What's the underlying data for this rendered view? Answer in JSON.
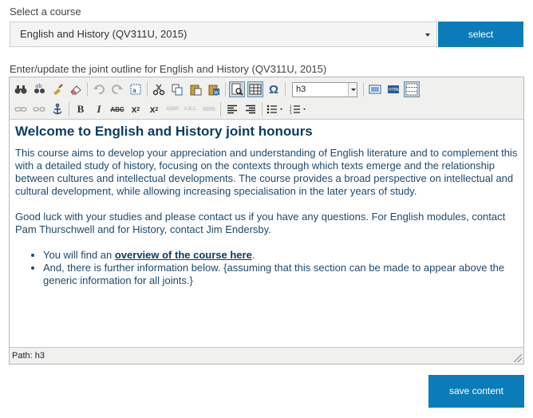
{
  "course_picker": {
    "label": "Select a course",
    "selected_value": "English and History (QV311U, 2015)",
    "button_label": "select"
  },
  "editor": {
    "label": "Enter/update the joint outline for English and History (QV311U, 2015)",
    "format_value": "h3",
    "toolbar_icons": {
      "find": "binoculars-icon",
      "replace": "find-replace-icon",
      "cleanup": "broom-icon",
      "remove_format": "eraser-icon",
      "undo": "undo-icon",
      "redo": "redo-icon",
      "select_all": "select-all-icon",
      "cut": "scissors-icon",
      "copy": "copy-icon",
      "paste": "paste-icon",
      "paste_word": "paste-word-icon",
      "preview": "preview-icon",
      "table": "table-icon",
      "char_map": "omega-icon"
    },
    "content": {
      "heading": "Welcome to English and History joint honours",
      "para1": "This course aims to develop your appreciation and understanding of English literature and to complement this with a detailed study of history, focusing on the contexts through which texts emerge and the relationship between cultures and intellectual developments. The course provides a broad perspective on intellectual and cultural development, while allowing increasing specialisation in the later years of study.",
      "para2": "Good luck with your studies and please contact us if you have any questions. For English modules, contact Pam Thurschwell and for History, contact Jim Endersby.",
      "bullet1_prefix": "You will find an ",
      "bullet1_link": "overview of the course here",
      "bullet1_suffix": ".",
      "bullet2": "And, there is further information below. {assuming that this section can be made to appear above the generic information for all joints.}"
    },
    "path": "Path: h3"
  },
  "save_label": "save content",
  "colors": {
    "accent": "#0a7db8",
    "content_text": "#1d4a6e",
    "heading_text": "#0c3d61"
  }
}
